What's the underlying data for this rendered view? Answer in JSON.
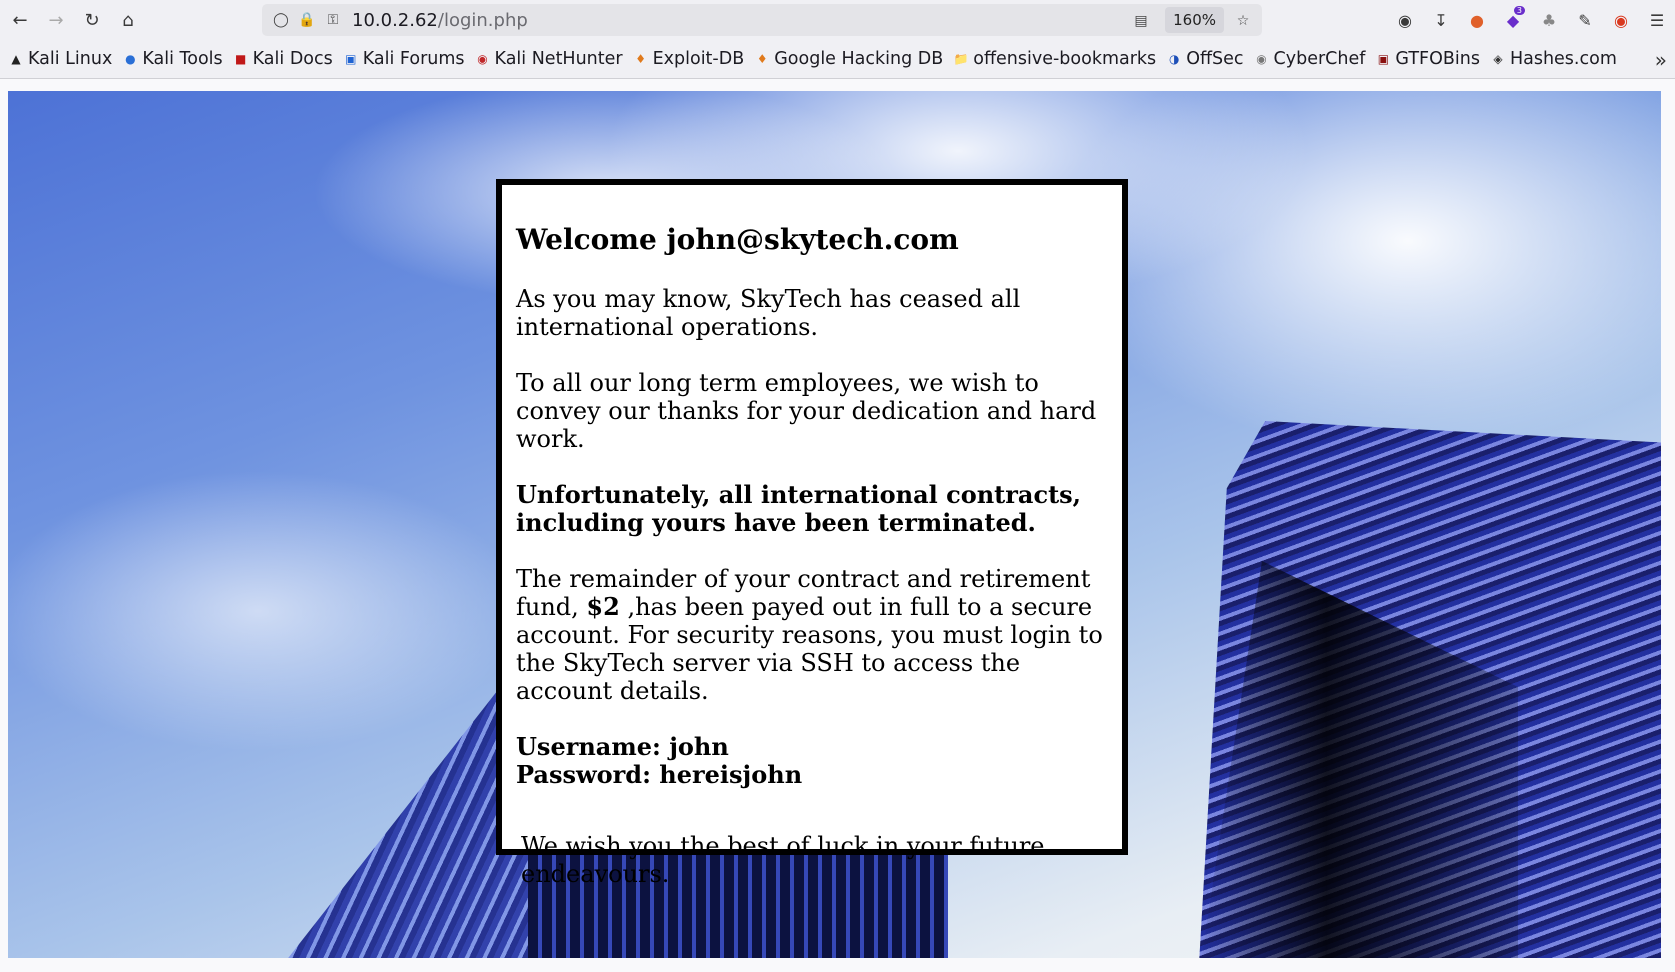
{
  "browser": {
    "url_host": "10.0.2.62",
    "url_path": "/login.php",
    "zoom": "160%",
    "extension_badge": "3"
  },
  "bookmarks": [
    {
      "label": "Kali Linux",
      "icon": "kali-icon"
    },
    {
      "label": "Kali Tools",
      "icon": "kali-tools-icon"
    },
    {
      "label": "Kali Docs",
      "icon": "kali-docs-icon"
    },
    {
      "label": "Kali Forums",
      "icon": "kali-forums-icon"
    },
    {
      "label": "Kali NetHunter",
      "icon": "nethunter-icon"
    },
    {
      "label": "Exploit-DB",
      "icon": "exploitdb-icon"
    },
    {
      "label": "Google Hacking DB",
      "icon": "ghdb-icon"
    },
    {
      "label": "offensive-bookmarks",
      "icon": "folder-icon"
    },
    {
      "label": "OffSec",
      "icon": "offsec-icon"
    },
    {
      "label": "CyberChef",
      "icon": "cyberchef-icon"
    },
    {
      "label": "GTFOBins",
      "icon": "gtfobins-icon"
    },
    {
      "label": "Hashes.com",
      "icon": "hashes-icon"
    }
  ],
  "page": {
    "heading": "Welcome john@skytech.com",
    "para1": "As you may know, SkyTech has ceased all international operations.",
    "para2": "To all our long term employees, we wish to convey our thanks for your dedication and hard work.",
    "para3": "Unfortunately, all international contracts, including yours have been terminated.",
    "para4_before": "The remainder of your contract and retirement fund, ",
    "para4_amount": "$2",
    "para4_after": " ,has been payed out in full to a secure account. For security reasons, you must login to the SkyTech server via SSH to access the account details.",
    "username_line": "Username: john",
    "password_line": "Password: hereisjohn",
    "closing_line1": "We wish you the best of luck in your future",
    "closing_line2": "endeavours."
  }
}
